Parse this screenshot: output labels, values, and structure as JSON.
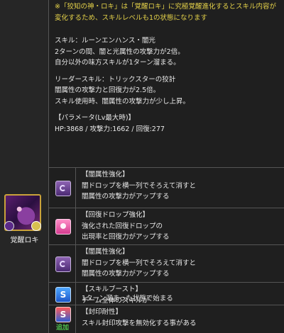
{
  "notice": "※「狡知の神・ロキ」は「覚醒ロキ」に究極覚醒進化するとスキル内容が変化するため、スキルレベルも1の状態になります",
  "skill": {
    "line1": "スキル：ルーンエンハンス・闇光",
    "line2": "2ターンの間、闇と光属性の攻撃力が2倍。",
    "line3": "自分以外の味方スキルが1ターン溜まる。"
  },
  "leader": {
    "line1": "リーダースキル：トリックスターの狡計",
    "line2": "闇属性の攻撃力と回復力が2.5倍。",
    "line3": "スキル使用時、闇属性の攻撃力が少し上昇。"
  },
  "params": {
    "title": "【パラメータ(Lv最大時)】",
    "stats": "HP:3868 / 攻撃力:1662 / 回復:277"
  },
  "character": {
    "name": "覚醒ロキ"
  },
  "awakenings": [
    {
      "icon": "dark-enhance-icon",
      "title": "【闇属性強化】",
      "desc1": "闇ドロップを横一列でそろえて消すと",
      "desc2": "闇属性の攻撃力がアップする"
    },
    {
      "icon": "heal-drop-enhance-icon",
      "title": "【回復ドロップ強化】",
      "desc1": "強化された回復ドロップの",
      "desc2": "出現率と回復力がアップする"
    },
    {
      "icon": "dark-enhance-icon",
      "title": "【闇属性強化】",
      "desc1": "闇ドロップを横一列でそろえて消すと",
      "desc2": "闇属性の攻撃力がアップする"
    },
    {
      "icon": "skill-boost-icon",
      "title": "【スキルブースト】",
      "desc1": "チーム全体のスキルが",
      "desc2": "1ターン溜まった状態で始まる"
    },
    {
      "icon": "seal-resist-icon",
      "title": "【封印耐性】",
      "desc1": "スキル封印攻撃を無効化する事がある",
      "tag": "追加"
    }
  ],
  "glyphs": {
    "boost": "S",
    "seal": "S"
  }
}
